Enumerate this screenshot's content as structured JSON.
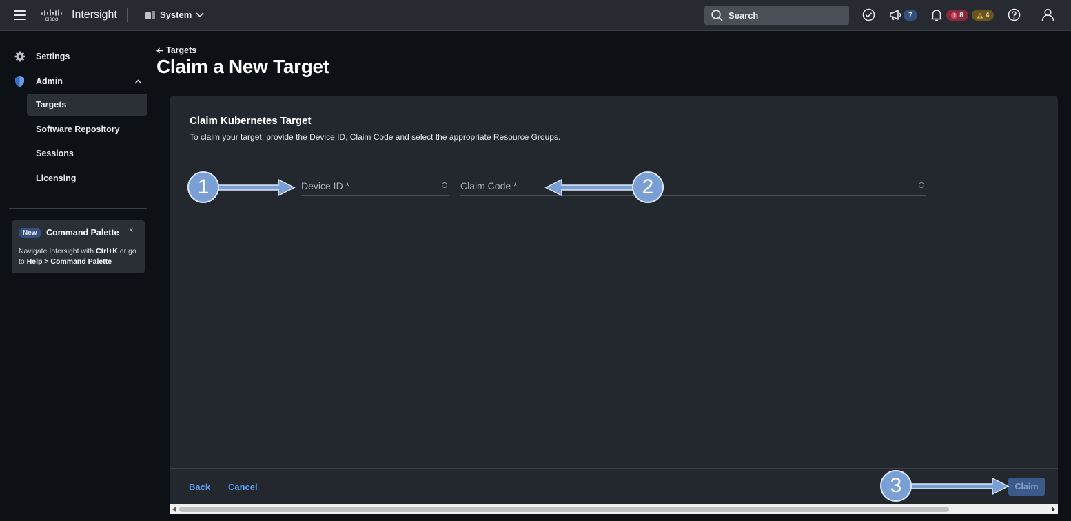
{
  "header": {
    "brand": "Intersight",
    "context": "System",
    "search_placeholder": "Search",
    "announcements_count": "7",
    "critical_alarms": "8",
    "warning_alarms": "4"
  },
  "sidebar": {
    "settings": "Settings",
    "admin": "Admin",
    "sub_items": [
      "Targets",
      "Software Repository",
      "Sessions",
      "Licensing"
    ],
    "promo": {
      "badge": "New",
      "title": "Command Palette",
      "close": "×",
      "text_1": "Navigate Intersight with ",
      "shortcut": "Ctrl+K",
      "text_2": " or go to ",
      "path": "Help > Command Palette"
    }
  },
  "page": {
    "breadcrumb": "Targets",
    "title": "Claim a New Target"
  },
  "form": {
    "title": "Claim Kubernetes Target",
    "description": "To claim your target, provide the Device ID, Claim Code and select the appropriate Resource Groups.",
    "device_id_placeholder": "Device ID *",
    "claim_code_placeholder": "Claim Code *"
  },
  "footer": {
    "back": "Back",
    "cancel": "Cancel",
    "claim": "Claim"
  },
  "annotations": [
    "1",
    "2",
    "3"
  ],
  "colors": {
    "accent": "#5b9bf0",
    "marker": "#7a9fd4",
    "critical": "#c8334a",
    "warning": "#c99a1e"
  }
}
